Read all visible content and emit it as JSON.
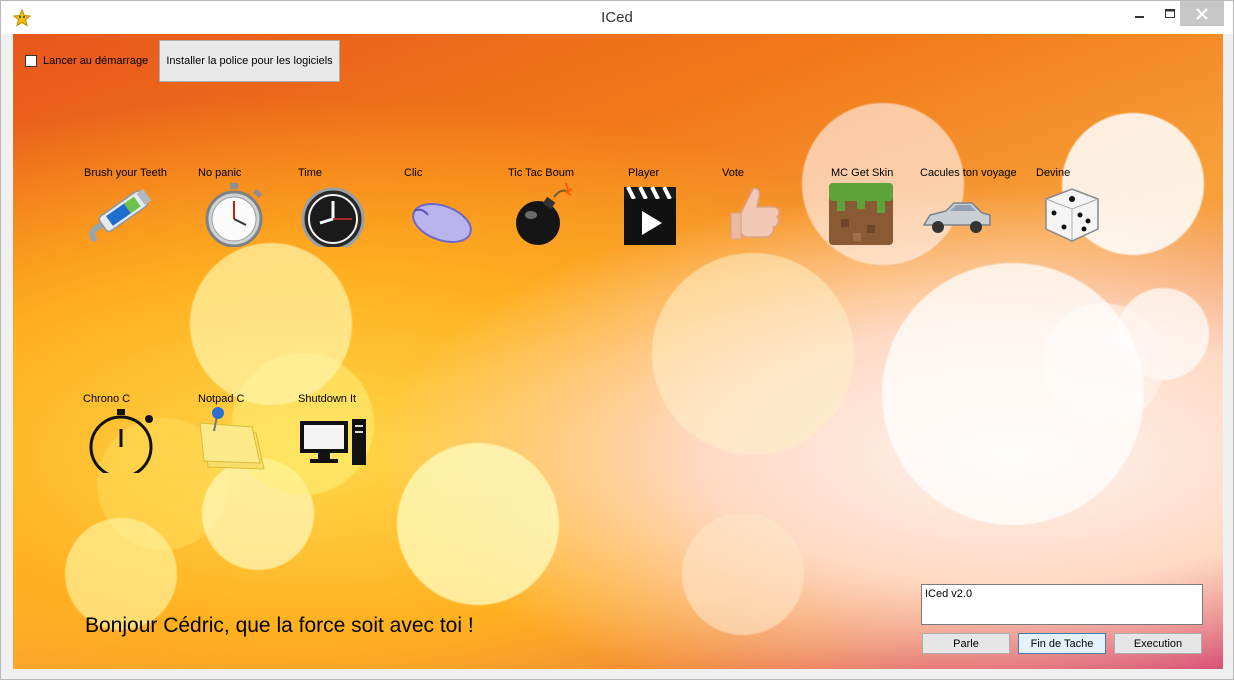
{
  "window": {
    "title": "ICed"
  },
  "options": {
    "autostart_label": "Lancer au démarrage",
    "install_font_label": "Installer la police pour les logiciels"
  },
  "apps": [
    {
      "label": "Brush your Teeth",
      "icon": "toothpaste-icon"
    },
    {
      "label": "No panic",
      "icon": "stopwatch-icon"
    },
    {
      "label": "Time",
      "icon": "clock-icon"
    },
    {
      "label": "Clic",
      "icon": "mouse-icon"
    },
    {
      "label": "Tic Tac Boum",
      "icon": "bomb-icon"
    },
    {
      "label": "Player",
      "icon": "clapperboard-icon"
    },
    {
      "label": "Vote",
      "icon": "thumbs-up-icon"
    },
    {
      "label": "MC Get Skin",
      "icon": "grass-block-icon"
    },
    {
      "label": "Cacules ton voyage",
      "icon": "car-icon"
    },
    {
      "label": "Devine",
      "icon": "dice-icon"
    },
    {
      "label": "Chrono C",
      "icon": "chrono-icon"
    },
    {
      "label": "Notpad C",
      "icon": "sticky-note-icon"
    },
    {
      "label": "Shutdown It",
      "icon": "computer-icon"
    }
  ],
  "greeting": "Bonjour Cédric, que la force soit avec toi !",
  "status": {
    "text": "ICed v2.0"
  },
  "buttons": {
    "parle": "Parle",
    "fin_de_tache": "Fin de Tache",
    "execution": "Execution"
  }
}
